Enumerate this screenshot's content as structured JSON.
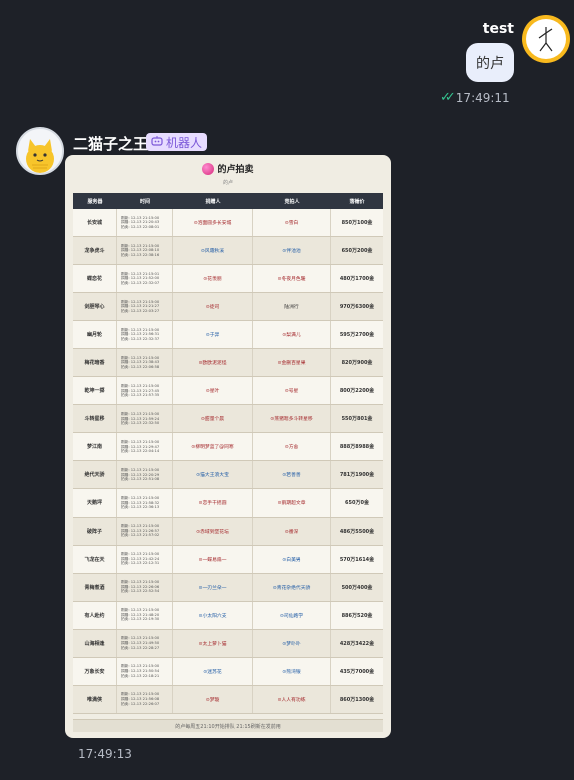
{
  "outgoing": {
    "sender_name": "test",
    "message": "的卢",
    "time": "17:49:11",
    "read_icon": "double-check-icon"
  },
  "incoming": {
    "sender_name": "二猫子之王",
    "bot_badge": "机器人",
    "time": "17:49:13",
    "card": {
      "title": "的卢拍卖",
      "subtitle": "的卢",
      "columns": [
        "服务器",
        "时间",
        "捐赠人",
        "竞拍人",
        "落锤价"
      ],
      "rows": [
        {
          "server": "长安城",
          "times": [
            "刷新: 12-13 21:15:00",
            "捐赠: 12-13 21:20:43",
            "拍卖: 12-13 22:08:01"
          ],
          "donor": "⊙泡面圆多长安城",
          "donor_color": "red",
          "bidder": "⊙雪白",
          "bidder_color": "red",
          "price": "850万100金"
        },
        {
          "server": "龙争虎斗",
          "times": [
            "刷新: 12-13 21:15:00",
            "捐赠: 12-13 22:08:10",
            "拍卖: 12-13 22:38:16"
          ],
          "donor": "⊙风霜秋溪",
          "donor_color": "blue",
          "bidder": "⊙伴池池",
          "bidder_color": "blue",
          "price": "650万200金"
        },
        {
          "server": "蝶恋花",
          "times": [
            "刷新: 12-13 21:15:01",
            "捐赠: 12-13 21:52:00",
            "拍卖: 12-13 22:32:07"
          ],
          "donor": "⊙花羡丽",
          "donor_color": "red",
          "bidder": "⊙冬夜月色暖",
          "bidder_color": "red",
          "price": "480万1700金"
        },
        {
          "server": "剑胆琴心",
          "times": [
            "刷新: 12-13 21:15:00",
            "捐赠: 12-13 21:21:27",
            "拍卖: 12-13 22:03:27"
          ],
          "donor": "⊙徒司",
          "donor_color": "red",
          "bidder": "陆洲行",
          "bidder_color": "dark",
          "price": "970万6300金"
        },
        {
          "server": "幽月轮",
          "times": [
            "刷新: 12-13 21:15:00",
            "捐赠: 12-13 21:56:31",
            "拍卖: 12-13 22:32:37"
          ],
          "donor": "⊙于羿",
          "donor_color": "blue",
          "bidder": "⊙梨满儿",
          "bidder_color": "red",
          "price": "595万2700金"
        },
        {
          "server": "梅花暗香",
          "times": [
            "刷新: 12-13 21:15:00",
            "捐赠: 12-13 21:38:43",
            "拍卖: 12-13 22:06:58"
          ],
          "donor": "⊙欧欧泥泥怪",
          "donor_color": "red",
          "bidder": "⊙金删百星果",
          "bidder_color": "red",
          "price": "820万900金"
        },
        {
          "server": "乾坤一掷",
          "times": [
            "刷新: 12-13 21:15:00",
            "捐赠: 12-13 21:27:45",
            "拍卖: 12-13 21:57:35"
          ],
          "donor": "⊙星叶",
          "donor_color": "red",
          "bidder": "⊙号星",
          "bidder_color": "red",
          "price": "800万2200金"
        },
        {
          "server": "斗转星移",
          "times": [
            "刷新: 12-13 21:15:00",
            "捐赠: 12-13 21:59:24",
            "拍卖: 12-13 22:32:50"
          ],
          "donor": "⊙甜量个晨",
          "donor_color": "red",
          "bidder": "⊙蒸猪嗯多斗转星移",
          "bidder_color": "red",
          "price": "550万801金"
        },
        {
          "server": "梦江南",
          "times": [
            "刷新: 12-13 21:15:00",
            "捐赠: 12-13 21:29:47",
            "拍卖: 12-13 22:04:14"
          ],
          "donor": "⊙柳明梦蓝了@同寒",
          "donor_color": "red",
          "bidder": "⊙方舍",
          "bidder_color": "red",
          "price": "888万8988金"
        },
        {
          "server": "绝代天骄",
          "times": [
            "刷新: 12-13 21:15:00",
            "捐赠: 12-13 22:20:29",
            "拍卖: 12-13 22:51:08"
          ],
          "donor": "⊙猫大王浪大宝",
          "donor_color": "blue",
          "bidder": "⊙若善善",
          "bidder_color": "blue",
          "price": "781万1900金"
        },
        {
          "server": "天鹅坪",
          "times": [
            "刷新: 12-13 21:15:00",
            "捐赠: 12-13 21:58:32",
            "拍卖: 12-13 22:36:13"
          ],
          "donor": "⊙恋手干摇圆",
          "donor_color": "red",
          "bidder": "⊙鹅期超文章",
          "bidder_color": "red",
          "price": "650万0金"
        },
        {
          "server": "破阵子",
          "times": [
            "刷新: 12-13 21:15:00",
            "捐赠: 12-13 21:26:57",
            "拍卖: 12-13 21:57:02"
          ],
          "donor": "⊙赤域到堡花坛",
          "donor_color": "red",
          "bidder": "⊙番深",
          "bidder_color": "red",
          "price": "486万5500金"
        },
        {
          "server": "飞龙在天",
          "times": [
            "刷新: 12-13 21:15:00",
            "捐赠: 12-13 21:42:24",
            "拍卖: 12-13 22:12:31"
          ],
          "donor": "⊙一蝶易扇一",
          "donor_color": "red",
          "bidder": "⊙白美男",
          "bidder_color": "blue",
          "price": "570万1614金"
        },
        {
          "server": "青梅煮酒",
          "times": [
            "刷新: 12-13 21:15:00",
            "捐赠: 12-13 22:26:06",
            "拍卖: 12-13 22:52:54"
          ],
          "donor": "⊙一刃兰朵一",
          "donor_color": "blue",
          "bidder": "⊙青花杂绝代天骄",
          "bidder_color": "blue",
          "price": "500万400金"
        },
        {
          "server": "有人赴约",
          "times": [
            "刷新: 12-13 21:15:00",
            "捐赠: 12-13 21:48:20",
            "拍卖: 12-13 22:19:30"
          ],
          "donor": "⊙小太阳六支",
          "donor_color": "blue",
          "bidder": "⊙司仙路学",
          "bidder_color": "blue",
          "price": "886万520金"
        },
        {
          "server": "山海相逢",
          "times": [
            "刷新: 12-13 21:15:00",
            "捐赠: 12-13 21:49:50",
            "拍卖: 12-13 22:28:27"
          ],
          "donor": "⊙太上萝卜猫",
          "donor_color": "red",
          "bidder": "⊙梦卟卟",
          "bidder_color": "blue",
          "price": "428万3422金"
        },
        {
          "server": "万象长安",
          "times": [
            "刷新: 12-13 21:15:00",
            "捐赠: 12-13 21:50:54",
            "拍卖: 12-13 22:18:21"
          ],
          "donor": "⊙迷苏花",
          "donor_color": "blue",
          "bidder": "⊙熊湾银",
          "bidder_color": "blue",
          "price": "435万7000金"
        },
        {
          "server": "唯满侠",
          "times": [
            "刷新: 12-13 21:15:00",
            "捐赠: 12-13 21:56:08",
            "拍卖: 12-13 22:26:07"
          ],
          "donor": "⊙梦璇",
          "donor_color": "red",
          "bidder": "⊙人人有功练",
          "bidder_color": "red",
          "price": "860万1300金"
        }
      ],
      "footer": "的卢每周五21:10开始排队 21:15刷新在发前用"
    }
  },
  "colors": {
    "background": "#1e2128",
    "bubble": "#e9eefb",
    "badge_bg": "#e7dcff",
    "badge_fg": "#7b57d8",
    "read_check": "#34c38f"
  }
}
